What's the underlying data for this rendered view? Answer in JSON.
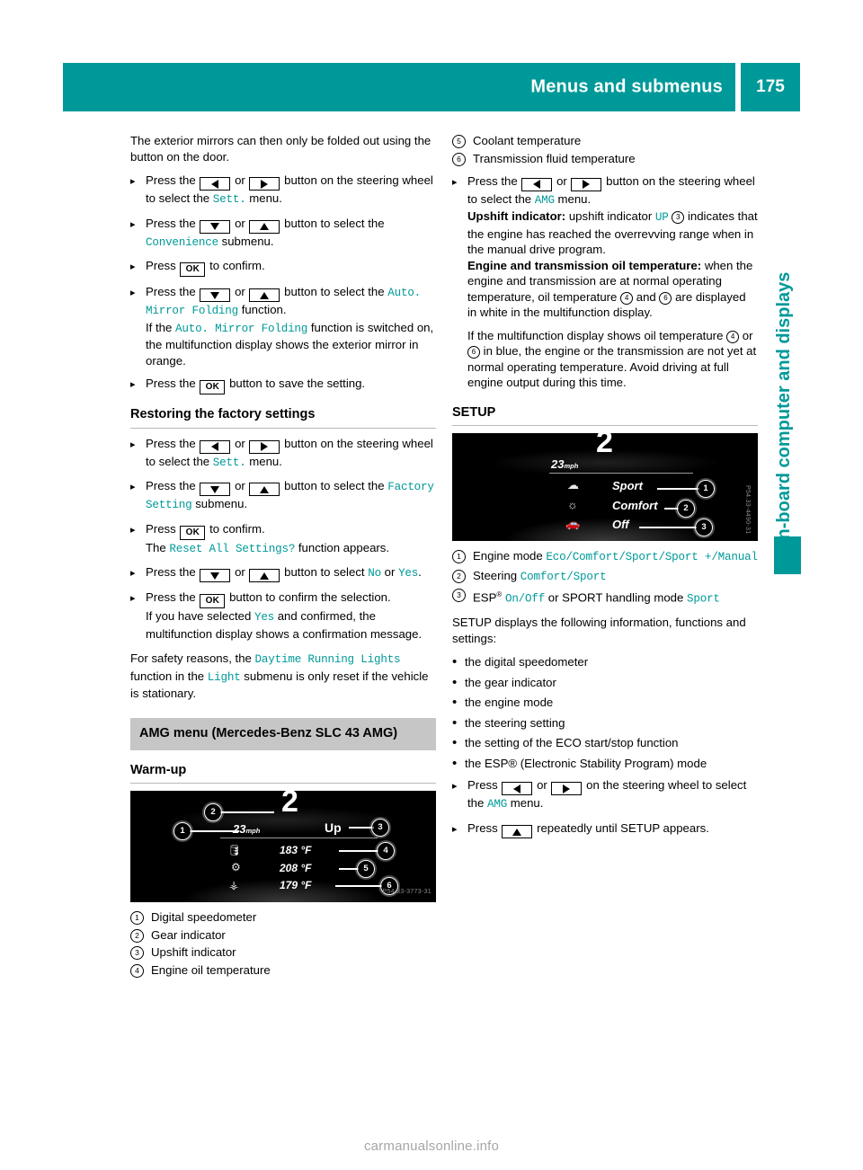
{
  "header": {
    "title": "Menus and submenus",
    "page_number": "175"
  },
  "side_tab": {
    "label": "On-board computer and displays"
  },
  "watermark": "carmanualsonline.info",
  "keys": {
    "left": "left-arrow",
    "right": "right-arrow",
    "up": "up-arrow",
    "down": "down-arrow",
    "ok": "OK"
  },
  "left_column": {
    "intro": "The exterior mirrors can then only be folded out using the button on the door.",
    "steps_mirror": [
      {
        "pre": "Press the",
        "key_a": "left",
        "or": "or",
        "key_b": "right",
        "mid": "button on the steering wheel to select the",
        "mono": "Sett.",
        "post": "menu."
      },
      {
        "pre": "Press the",
        "key_a": "down",
        "or": "or",
        "key_b": "up",
        "mid": "button to select the",
        "mono": "Convenience",
        "post": "submenu."
      },
      {
        "pre": "Press",
        "key_ok": "OK",
        "post": "to confirm."
      },
      {
        "pre": "Press the",
        "key_a": "down",
        "or": "or",
        "key_b": "up",
        "mid": "button to select the",
        "mono": "Auto. Mirror Folding",
        "post": "function.",
        "extra_pre": "If the",
        "extra_mono": "Auto. Mirror Folding",
        "extra_post": "function is switched on, the multifunction display shows the exterior mirror in orange."
      },
      {
        "pre": "Press the",
        "key_ok": "OK",
        "post": "button to save the setting."
      }
    ],
    "factory_heading": "Restoring the factory settings",
    "steps_factory": [
      {
        "pre": "Press the",
        "key_a": "left",
        "or": "or",
        "key_b": "right",
        "mid": "button on the steering wheel to select the",
        "mono": "Sett.",
        "post": "menu."
      },
      {
        "pre": "Press the",
        "key_a": "down",
        "or": "or",
        "key_b": "up",
        "mid": "button to select the",
        "mono": "Factory Setting",
        "post": "submenu."
      },
      {
        "pre": "Press",
        "key_ok": "OK",
        "post": "to confirm.",
        "extra_pre": "The",
        "extra_mono": "Reset All Settings?",
        "extra_post": "function appears."
      },
      {
        "pre": "Press the",
        "key_a": "down",
        "or": "or",
        "key_b": "up",
        "mid": "button to select",
        "mono": "No",
        "mid2": "or",
        "mono2": "Yes",
        "post": "."
      },
      {
        "pre": "Press the",
        "key_ok": "OK",
        "post": "button to confirm the selection.",
        "extra_pre": "If you have selected",
        "extra_mono": "Yes",
        "extra_post": "and confirmed, the multifunction display shows a confirmation message."
      }
    ],
    "safety_note": {
      "pre": "For safety reasons, the",
      "mono1": "Daytime Running Lights",
      "mid": "function in the",
      "mono2": "Light",
      "post": "submenu is only reset if the vehicle is stationary."
    },
    "amg_box": "AMG menu (Mercedes-Benz SLC 43 AMG)",
    "warmup_heading": "Warm-up",
    "warmup_display": {
      "speed": "23",
      "speed_unit": "mph",
      "gear": "2",
      "upshift": "Up",
      "engine_oil_temp": "183 °F",
      "coolant_temp": "208 °F",
      "transmission_temp": "179 °F",
      "image_code": "P54.33-3773-31",
      "callouts": [
        "1",
        "2",
        "3",
        "4",
        "5",
        "6"
      ]
    },
    "warmup_legend": [
      {
        "num": "1",
        "text": "Digital speedometer"
      },
      {
        "num": "2",
        "text": "Gear indicator"
      },
      {
        "num": "3",
        "text": "Upshift indicator"
      },
      {
        "num": "4",
        "text": "Engine oil temperature"
      }
    ]
  },
  "right_column": {
    "legend_cont": [
      {
        "num": "5",
        "text": "Coolant temperature"
      },
      {
        "num": "6",
        "text": "Transmission fluid temperature"
      }
    ],
    "amg_step": {
      "pre": "Press the",
      "key_a": "left",
      "or": "or",
      "key_b": "right",
      "mid": "button on the steering wheel to select the",
      "mono": "AMG",
      "post": "menu."
    },
    "upshift_note": {
      "label": "Upshift indicator:",
      "pre": "upshift indicator",
      "mono": "UP",
      "num": "3",
      "post": "indicates that the engine has reached the overrevving range when in the manual drive program."
    },
    "oil_note": {
      "label": "Engine and transmission oil temperature:",
      "part1": "when the engine and transmission are at normal operating temperature, oil temperature",
      "num_a": "4",
      "and": "and",
      "num_b": "6",
      "part2": "are displayed in white in the multifunction display."
    },
    "blue_note": {
      "part1": "If the multifunction display shows oil temperature",
      "num_a": "4",
      "or": "or",
      "num_b": "6",
      "part2": "in blue, the engine or the transmission are not yet at normal operating temperature. Avoid driving at full engine output during this time."
    },
    "setup_heading": "SETUP",
    "setup_display": {
      "speed": "23",
      "speed_unit": "mph",
      "gear": "2",
      "engine_mode": "Sport",
      "steering": "Comfort",
      "esp": "Off",
      "image_code": "P54.33-4490-31",
      "callouts": [
        "1",
        "2",
        "3"
      ]
    },
    "setup_legend": [
      {
        "num": "1",
        "label": "Engine mode",
        "values": "Eco/Comfort/Sport/Sport +/Manual"
      },
      {
        "num": "2",
        "label": "Steering",
        "values": "Comfort/Sport"
      },
      {
        "num": "3",
        "label": "ESP",
        "sup": "®",
        "values": "On/Off",
        "tail": "or SPORT handling mode",
        "values2": "Sport"
      }
    ],
    "setup_intro": "SETUP displays the following information, functions and settings:",
    "setup_bullets": [
      "the digital speedometer",
      "the gear indicator",
      "the engine mode",
      "the steering setting",
      "the setting of the ECO start/stop function",
      "the ESP® (Electronic Stability Program) mode"
    ],
    "setup_steps": [
      {
        "pre": "Press",
        "key_a": "left",
        "or": "or",
        "key_b": "right",
        "mid": "on the steering wheel to select the",
        "mono": "AMG",
        "post": "menu."
      },
      {
        "pre": "Press",
        "key_a": "up",
        "post": "repeatedly until SETUP appears."
      }
    ]
  },
  "colors": {
    "teal": "#009999",
    "grey_box": "#c6c6c6",
    "rule": "#b9b9b9"
  }
}
